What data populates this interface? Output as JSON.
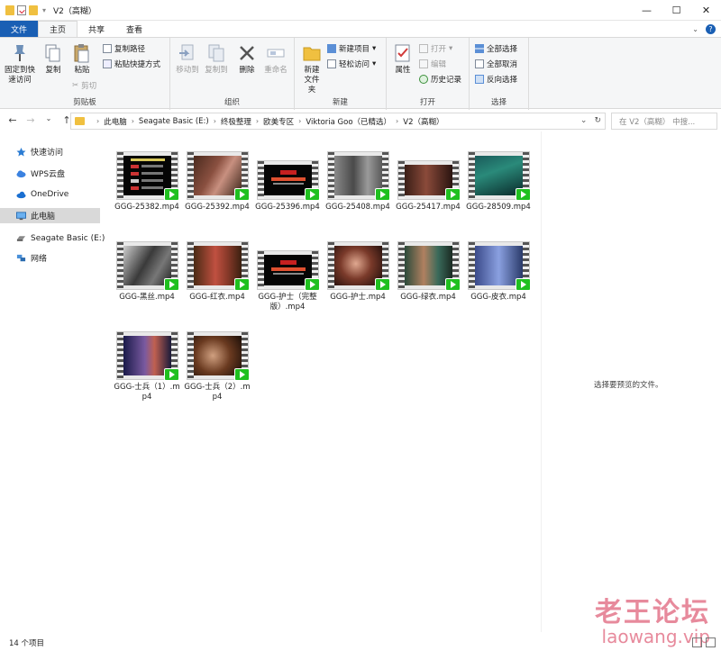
{
  "window": {
    "title": "V2（高糊）",
    "controls": [
      "—",
      "☐",
      "✕"
    ]
  },
  "ribbon_tabs": {
    "file": "文件",
    "home": "主页",
    "share": "共享",
    "view": "查看"
  },
  "ribbon": {
    "clipboard": {
      "label": "剪贴板",
      "pin": "固定到快速访问",
      "copy": "复制",
      "paste": "粘贴",
      "copy_path": "复制路径",
      "paste_shortcut": "粘贴快捷方式",
      "cut": "剪切"
    },
    "organize": {
      "label": "组织",
      "move_to": "移动到",
      "copy_to": "复制到",
      "delete": "删除",
      "rename": "重命名"
    },
    "new": {
      "label": "新建",
      "new_folder": "新建文件夹",
      "new_item": "新建项目",
      "easy_access": "轻松访问"
    },
    "open": {
      "label": "打开",
      "properties": "属性",
      "open": "打开",
      "edit": "编辑",
      "history": "历史记录"
    },
    "select": {
      "label": "选择",
      "select_all": "全部选择",
      "select_none": "全部取消",
      "invert": "反向选择"
    }
  },
  "address": {
    "crumbs": [
      "此电脑",
      "Seagate Basic (E:)",
      "终极整理",
      "欧美专区",
      "Viktoria Goo（已精选）",
      "V2（高糊）"
    ],
    "search_placeholder": "在 V2（高糊） 中搜..."
  },
  "nav": {
    "quick_access": "快速访问",
    "wps": "WPS云盘",
    "onedrive": "OneDrive",
    "this_pc": "此电脑",
    "seagate": "Seagate Basic (E:)",
    "network": "网络"
  },
  "files": [
    {
      "name": "GGG-25382.mp4"
    },
    {
      "name": "GGG-25392.mp4"
    },
    {
      "name": "GGG-25396.mp4"
    },
    {
      "name": "GGG-25408.mp4"
    },
    {
      "name": "GGG-25417.mp4"
    },
    {
      "name": "GGG-28509.mp4"
    },
    {
      "name": "GGG-黑丝.mp4"
    },
    {
      "name": "GGG-红衣.mp4"
    },
    {
      "name": "GGG-护士（完整版）.mp4"
    },
    {
      "name": "GGG-护士.mp4"
    },
    {
      "name": "GGG-绿衣.mp4"
    },
    {
      "name": "GGG-皮衣.mp4"
    },
    {
      "name": "GGG-士兵（1）.mp4"
    },
    {
      "name": "GGG-士兵（2）.mp4"
    }
  ],
  "preview_text": "选择要预览的文件。",
  "status": "14 个项目",
  "watermark": {
    "line1": "老王论坛",
    "line2": "laowang.vip"
  },
  "colors": {
    "accent": "#1a5fb4",
    "badge": "#1fc01f",
    "folder": "#f0c040"
  }
}
